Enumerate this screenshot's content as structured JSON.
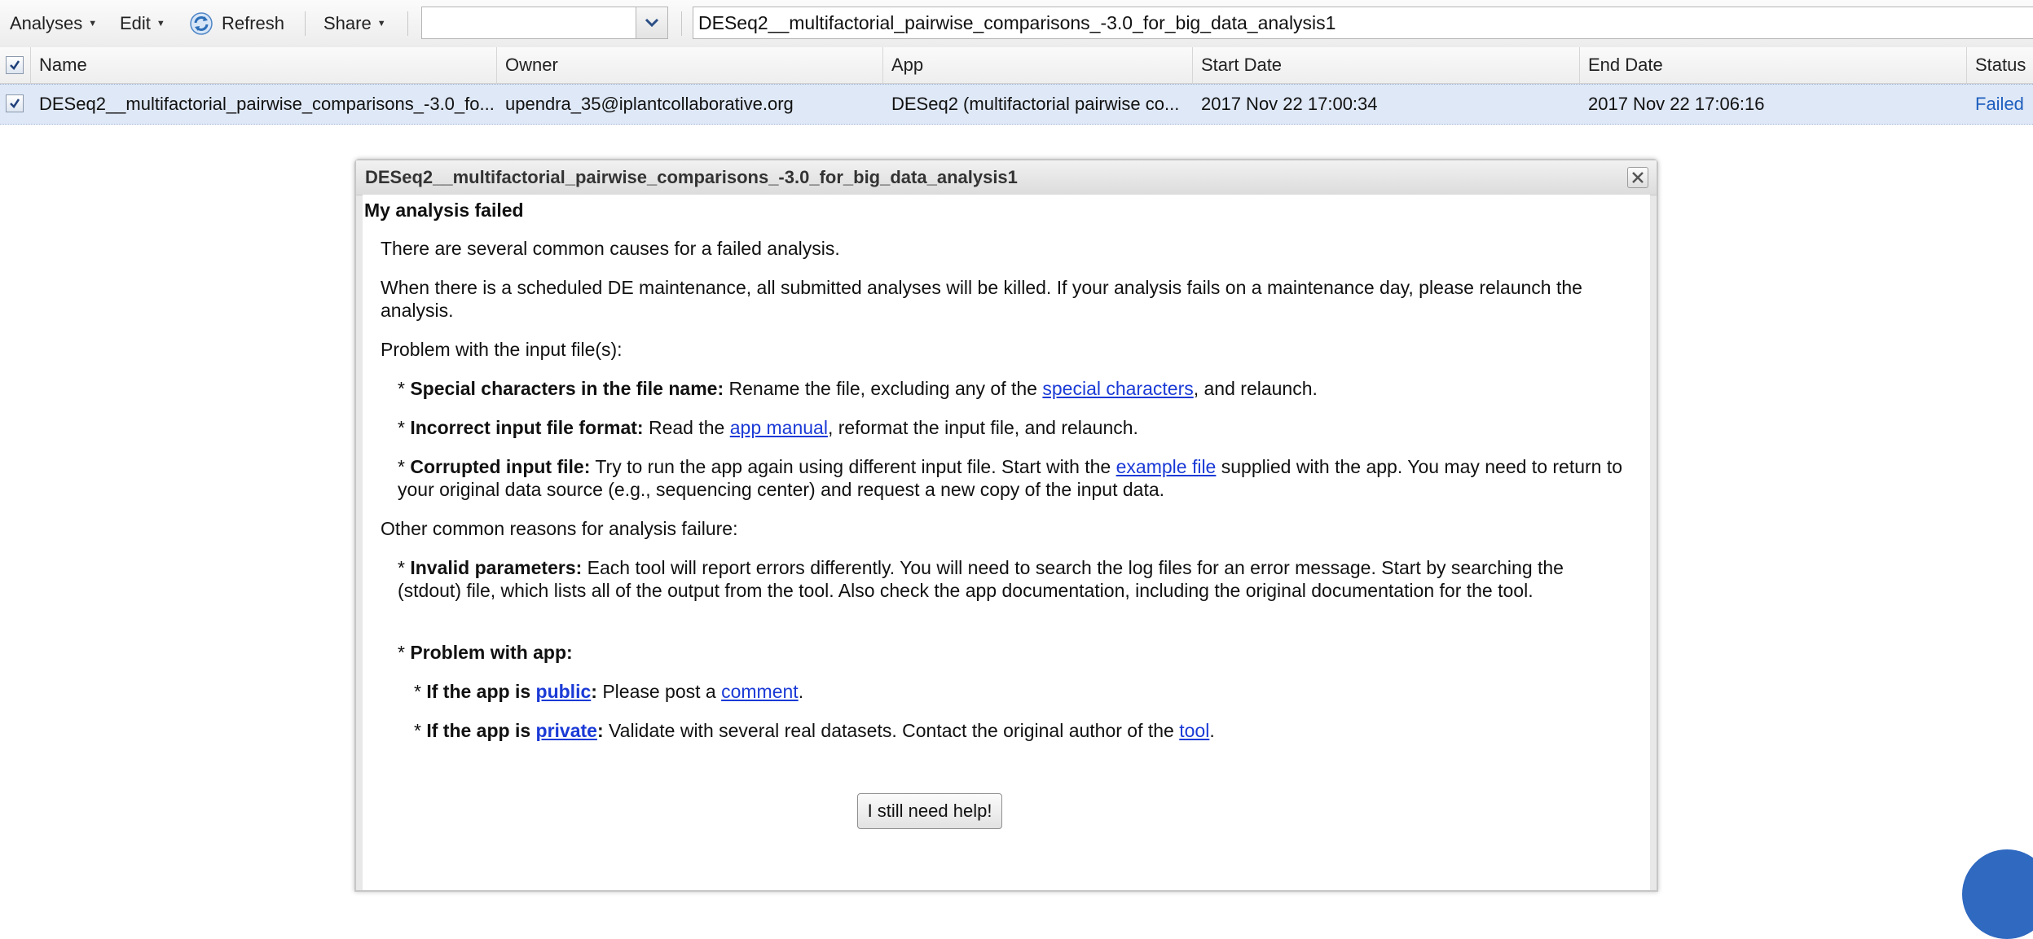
{
  "toolbar": {
    "analyses_label": "Analyses",
    "edit_label": "Edit",
    "refresh_label": "Refresh",
    "share_label": "Share",
    "filter_combo": {
      "value": ""
    },
    "search_value": "DESeq2__multifactorial_pairwise_comparisons_-3.0_for_big_data_analysis1"
  },
  "grid": {
    "columns": [
      "Name",
      "Owner",
      "App",
      "Start Date",
      "End Date",
      "Status"
    ],
    "rows": [
      {
        "name": "DESeq2__multifactorial_pairwise_comparisons_-3.0_fo...",
        "owner": "upendra_35@iplantcollaborative.org",
        "app": "DESeq2 (multifactorial pairwise co...",
        "start_date": "2017 Nov 22 17:00:34",
        "end_date": "2017 Nov 22 17:06:16",
        "status": "Failed",
        "checked": true
      }
    ]
  },
  "dialog": {
    "title": "DESeq2__multifactorial_pairwise_comparisons_-3.0_for_big_data_analysis1",
    "heading": "My analysis failed",
    "intro": "There are several common causes for a failed analysis.",
    "maintenance": "When there is a scheduled DE maintenance, all submitted analyses will be killed. If your analysis fails on a maintenance day, please relaunch the analysis.",
    "input_problem_heading": "Problem with the input file(s):",
    "special_chars": {
      "bullet": "* ",
      "label": "Special characters in the file name:",
      "text_before": " Rename the file, excluding any of the ",
      "link": "special characters",
      "text_after": ", and relaunch."
    },
    "incorrect_format": {
      "bullet": "* ",
      "label": "Incorrect input file format:",
      "text_before": " Read the ",
      "link": "app manual",
      "text_after": ", reformat the input file, and relaunch."
    },
    "corrupted": {
      "bullet": "* ",
      "label": "Corrupted input file:",
      "text_before": " Try to run the app again using different input file. Start with the ",
      "link": "example file",
      "text_after": " supplied with the app. You may need to return to your original data source (e.g., sequencing center) and request a new copy of the input data."
    },
    "other_reasons_heading": "Other common reasons for analysis failure:",
    "invalid_params": {
      "bullet": "* ",
      "label": "Invalid parameters:",
      "text": " Each tool will report errors differently. You will need to search the log files for an error message. Start by searching the (stdout) file, which lists all of the output from the tool. Also check the app documentation, including the original documentation for the tool."
    },
    "problem_app": {
      "bullet": "* ",
      "label": "Problem with app:"
    },
    "public_app": {
      "bullet": "* ",
      "label_before": "If the app is ",
      "label_link": "public",
      "label_after": ":",
      "text_before": " Please post a ",
      "link": "comment",
      "text_after": "."
    },
    "private_app": {
      "bullet": "* ",
      "label_before": "If the app is ",
      "label_link": "private",
      "label_after": ":",
      "text_before": " Validate with several real datasets. Contact the original author of the ",
      "link": "tool",
      "text_after": "."
    },
    "help_button": "I still need help!"
  },
  "colors": {
    "selected_row": "#dfe8f6",
    "status_failed": "#1f5fbf",
    "link": "#1a3ad6",
    "corner_accent": "#2f69c0"
  }
}
